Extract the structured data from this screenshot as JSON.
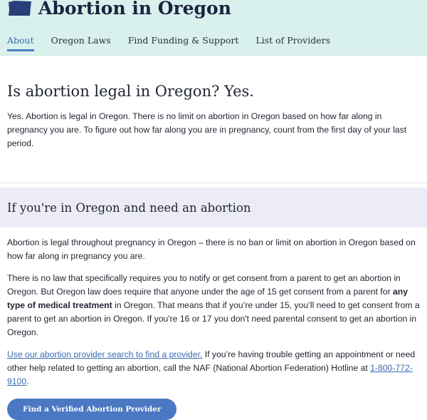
{
  "header": {
    "title": "Abortion in Oregon",
    "tabs": [
      {
        "label": "About",
        "active": true
      },
      {
        "label": "Oregon Laws",
        "active": false
      },
      {
        "label": "Find Funding & Support",
        "active": false
      },
      {
        "label": "List of Providers",
        "active": false
      }
    ]
  },
  "legal_section": {
    "heading": "Is abortion legal in Oregon? Yes.",
    "body": "Yes. Abortion is legal in Oregon. There is no limit on abortion in Oregon based on how far along in pregnancy you are. To figure out how far along you are in pregnancy, count from the first day of your last period."
  },
  "need_section": {
    "heading": "If you're in Oregon and need an abortion",
    "para1": "Abortion is legal throughout pregnancy in Oregon – there is no ban or limit on abortion in Oregon based on how far along in pregnancy you are.",
    "para2_part1": "There is no law that specifically requires you to notify or get consent from a parent to get an abortion in Oregon. But Oregon law does require that anyone under the age of 15 get consent from a parent for ",
    "para2_bold": "any type of medical treatment",
    "para2_part2": " in Oregon. That means that if you’re under 15, you’ll need to get consent from a parent to get an abortion in Oregon. If you're 16 or 17 you don't need parental consent to get an abortion in Oregon.",
    "para3_link": "Use our abortion provider search to find a provider.",
    "para3_text": " If you’re having trouble getting an appointment or need other help related to getting an abortion, call the NAF (National Abortion Federation) Hotline at ",
    "hotline": "1-800-772-9100",
    "para3_end": ".",
    "cta_label": "Find a Verified Abortion Provider"
  },
  "colors": {
    "header_bg": "#d8f1ec",
    "accent": "#4a78c2",
    "section_band": "#ececf8"
  },
  "icons": {
    "state": "oregon-state-icon"
  }
}
